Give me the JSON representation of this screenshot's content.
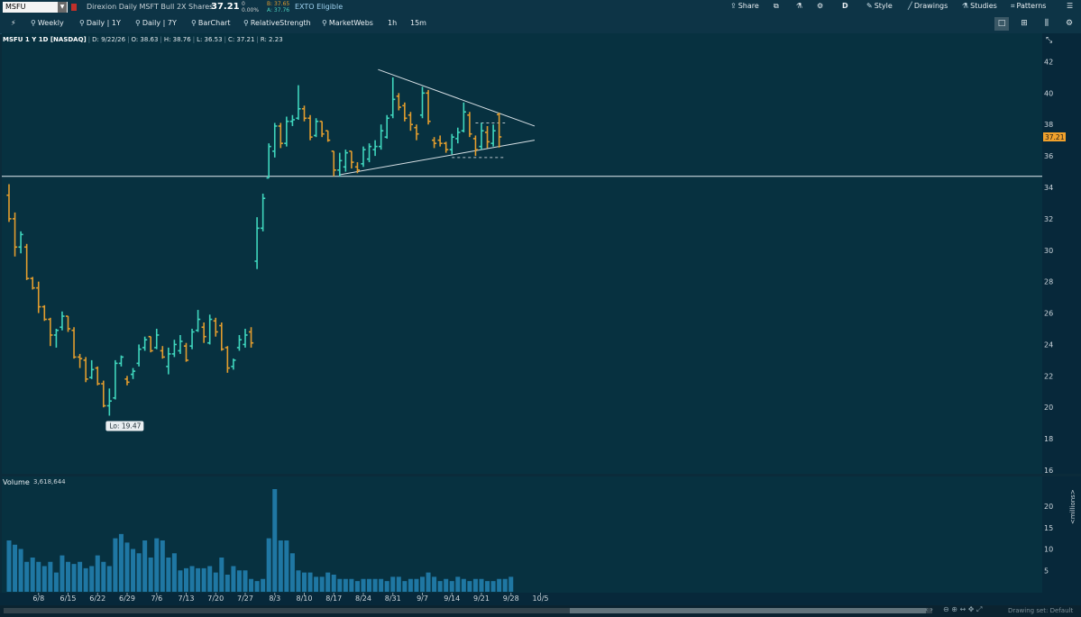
{
  "symbol": "MSFU",
  "description": "Direxion Daily MSFT Bull 2X Shares",
  "last_price": "37.21",
  "change": "0",
  "change_pct": "0.00%",
  "bid": "B: 37.65",
  "ask": "A: 37.76",
  "exto": "EXTO Eligible",
  "top_right": {
    "share": "Share",
    "d": "D",
    "style": "Style",
    "drawings": "Drawings",
    "studies": "Studies",
    "patterns": "Patterns"
  },
  "toolbar": {
    "items": [
      "Weekly",
      "Daily | 1Y",
      "Daily | 7Y",
      "BarChart",
      "RelativeStrength",
      "MarketWebs",
      "1h",
      "15m"
    ]
  },
  "headline": {
    "symbol": "MSFU 1 Y 1D [NASDAQ]",
    "date": "D: 9/22/26",
    "open": "O: 38.63",
    "high": "H: 38.76",
    "low": "L: 36.53",
    "close": "C: 37.21",
    "range": "R: 2.23"
  },
  "price_badge": "37.21",
  "low_label": "Lo: 19.47",
  "volume": {
    "label": "Volume",
    "value": "3,618,644",
    "unit": "<millions>"
  },
  "drawing_set": "Drawing set: Default",
  "colors": {
    "up": "#3fd6bd",
    "down": "#e29d2e",
    "neutral": "#b9c4ca",
    "volume": "#1f77a3",
    "bg": "#073140"
  },
  "chart_data": [
    {
      "type": "ohlc",
      "ylim": [
        16,
        43
      ],
      "yticks": [
        16,
        18,
        20,
        22,
        24,
        26,
        28,
        30,
        32,
        34,
        36,
        38,
        40,
        42
      ],
      "xticks": [
        "6/8",
        "6/15",
        "6/22",
        "6/29",
        "7/6",
        "7/13",
        "7/20",
        "7/27",
        "8/3",
        "8/10",
        "8/17",
        "8/24",
        "8/31",
        "9/7",
        "9/14",
        "9/21",
        "9/28",
        "10/5"
      ],
      "xtick_index": [
        5,
        10,
        15,
        20,
        25,
        30,
        35,
        40,
        45,
        50,
        55,
        60,
        65,
        70,
        75,
        80,
        85,
        90
      ],
      "horizontal_line": 34.7,
      "trendlines": [
        {
          "from": [
            62.5,
            41.5
          ],
          "to": [
            89,
            37.9
          ]
        },
        {
          "from": [
            56,
            34.8
          ],
          "to": [
            89,
            37.0
          ]
        }
      ],
      "dashed_levels": [
        {
          "from": 79,
          "to": 84,
          "y": 38.1
        },
        {
          "from": 75,
          "to": 84,
          "y": 35.9
        }
      ],
      "bars": [
        [
          33.5,
          34.2,
          31.8,
          32.0
        ],
        [
          32.0,
          32.4,
          29.6,
          30.2
        ],
        [
          30.2,
          31.2,
          29.8,
          31.0
        ],
        [
          30.2,
          30.4,
          28.1,
          28.2
        ],
        [
          28.2,
          28.3,
          27.5,
          27.6
        ],
        [
          27.6,
          28.0,
          26.0,
          26.4
        ],
        [
          26.4,
          26.5,
          25.5,
          25.6
        ],
        [
          25.6,
          25.7,
          23.9,
          24.6
        ],
        [
          24.6,
          25.0,
          23.8,
          24.9
        ],
        [
          25.1,
          26.1,
          24.9,
          25.8
        ],
        [
          25.8,
          25.8,
          24.8,
          25.0
        ],
        [
          24.9,
          25.1,
          23.1,
          23.2
        ],
        [
          23.2,
          23.4,
          22.5,
          23.1
        ],
        [
          23.0,
          23.2,
          21.6,
          21.8
        ],
        [
          21.9,
          23.0,
          21.8,
          22.4
        ],
        [
          22.5,
          22.6,
          21.4,
          21.5
        ],
        [
          21.5,
          21.7,
          20.0,
          20.1
        ],
        [
          20.1,
          21.2,
          19.47,
          20.4
        ],
        [
          20.6,
          23.0,
          20.5,
          22.8
        ],
        [
          22.8,
          23.3,
          22.6,
          23.2
        ],
        [
          21.8,
          22.0,
          21.4,
          21.6
        ],
        [
          22.1,
          22.5,
          21.8,
          22.3
        ],
        [
          22.8,
          24.0,
          22.6,
          23.7
        ],
        [
          23.8,
          24.5,
          23.6,
          24.3
        ],
        [
          24.5,
          24.5,
          23.5,
          23.6
        ],
        [
          23.8,
          25.0,
          23.7,
          24.6
        ],
        [
          23.6,
          23.9,
          23.1,
          23.2
        ],
        [
          22.6,
          23.8,
          22.1,
          23.4
        ],
        [
          23.4,
          24.3,
          23.2,
          24.0
        ],
        [
          23.6,
          24.6,
          23.4,
          24.2
        ],
        [
          23.9,
          24.1,
          22.9,
          23.0
        ],
        [
          23.9,
          25.0,
          23.7,
          24.8
        ],
        [
          24.9,
          26.2,
          24.8,
          25.6
        ],
        [
          25.1,
          25.4,
          24.1,
          24.5
        ],
        [
          24.1,
          25.9,
          24.0,
          25.6
        ],
        [
          25.5,
          25.7,
          24.5,
          24.8
        ],
        [
          25.2,
          25.4,
          23.6,
          23.7
        ],
        [
          23.8,
          23.9,
          22.2,
          22.5
        ],
        [
          22.6,
          23.1,
          22.4,
          23.0
        ],
        [
          23.8,
          24.6,
          23.6,
          24.3
        ],
        [
          24.0,
          25.0,
          23.8,
          24.6
        ],
        [
          24.8,
          25.1,
          23.8,
          24.1
        ],
        [
          29.3,
          32.1,
          28.8,
          31.4
        ],
        [
          31.4,
          33.6,
          31.2,
          33.3
        ],
        [
          34.6,
          36.8,
          34.6,
          36.6
        ],
        [
          36.3,
          38.1,
          35.9,
          37.9
        ],
        [
          37.9,
          38.1,
          36.5,
          36.8
        ],
        [
          36.8,
          38.5,
          36.6,
          38.2
        ],
        [
          38.2,
          38.6,
          37.9,
          38.3
        ],
        [
          38.4,
          40.5,
          38.3,
          39.0
        ],
        [
          39.0,
          39.2,
          38.2,
          38.4
        ],
        [
          38.4,
          38.6,
          37.0,
          37.2
        ],
        [
          37.3,
          38.4,
          37.2,
          38.2
        ],
        [
          38.2,
          38.2,
          37.2,
          37.4
        ],
        [
          37.6,
          37.6,
          36.9,
          37.0
        ],
        [
          36.3,
          36.3,
          34.7,
          35.1
        ],
        [
          35.1,
          36.2,
          34.7,
          35.7
        ],
        [
          35.3,
          36.4,
          35.0,
          36.2
        ],
        [
          36.3,
          36.3,
          35.2,
          35.6
        ],
        [
          35.3,
          35.6,
          34.9,
          35.1
        ],
        [
          35.5,
          36.6,
          35.3,
          36.4
        ],
        [
          35.8,
          36.8,
          35.6,
          36.6
        ],
        [
          36.4,
          37.0,
          36.0,
          36.6
        ],
        [
          36.6,
          38.0,
          36.4,
          37.6
        ],
        [
          37.2,
          38.6,
          37.1,
          38.4
        ],
        [
          38.6,
          41.0,
          38.4,
          39.6
        ],
        [
          39.8,
          40.0,
          38.9,
          39.1
        ],
        [
          39.2,
          39.4,
          38.2,
          38.4
        ],
        [
          38.6,
          38.8,
          37.6,
          38.0
        ],
        [
          37.8,
          38.0,
          37.0,
          37.4
        ],
        [
          38.6,
          40.4,
          38.4,
          40.0
        ],
        [
          40.0,
          40.2,
          38.0,
          38.2
        ],
        [
          37.0,
          37.2,
          36.5,
          36.8
        ],
        [
          37.0,
          37.3,
          36.6,
          36.8
        ],
        [
          36.8,
          36.9,
          36.2,
          36.4
        ],
        [
          36.4,
          37.4,
          36.1,
          37.2
        ],
        [
          37.1,
          37.8,
          36.8,
          37.5
        ],
        [
          37.6,
          39.4,
          37.5,
          38.8
        ],
        [
          38.6,
          38.8,
          37.2,
          37.4
        ],
        [
          37.1,
          37.3,
          36.0,
          36.4
        ],
        [
          36.6,
          38.1,
          36.4,
          37.6
        ],
        [
          37.5,
          37.9,
          36.5,
          36.9
        ],
        [
          36.8,
          38.0,
          36.6,
          37.6
        ],
        [
          38.63,
          38.76,
          36.53,
          37.21
        ]
      ]
    },
    {
      "type": "bar",
      "name": "Volume",
      "ylabel": "<millions>",
      "ylim": [
        0,
        24
      ],
      "yticks": [
        5,
        10,
        15,
        20
      ],
      "values": [
        12,
        11,
        10,
        7,
        8,
        7,
        6,
        7,
        4.5,
        8.5,
        7,
        6.5,
        7,
        5.5,
        6,
        8.5,
        7,
        6,
        12.5,
        13.5,
        11.5,
        10,
        9,
        12,
        8,
        12.5,
        12,
        8,
        9,
        5,
        5.5,
        6,
        5.5,
        5.5,
        6,
        4.5,
        8,
        4,
        6,
        5,
        5,
        3,
        2.5,
        3,
        12.5,
        24,
        12,
        12,
        9,
        5,
        4.5,
        4.5,
        3.5,
        3.5,
        4.5,
        4,
        3,
        3,
        3,
        2.5,
        3,
        3,
        3,
        3,
        2.5,
        3.5,
        3.5,
        2.5,
        3,
        3,
        3.5,
        4.5,
        3.5,
        2.5,
        3,
        2.5,
        3.5,
        3,
        2.5,
        3,
        3,
        2.5,
        2.5,
        3,
        3,
        3.5
      ]
    }
  ]
}
